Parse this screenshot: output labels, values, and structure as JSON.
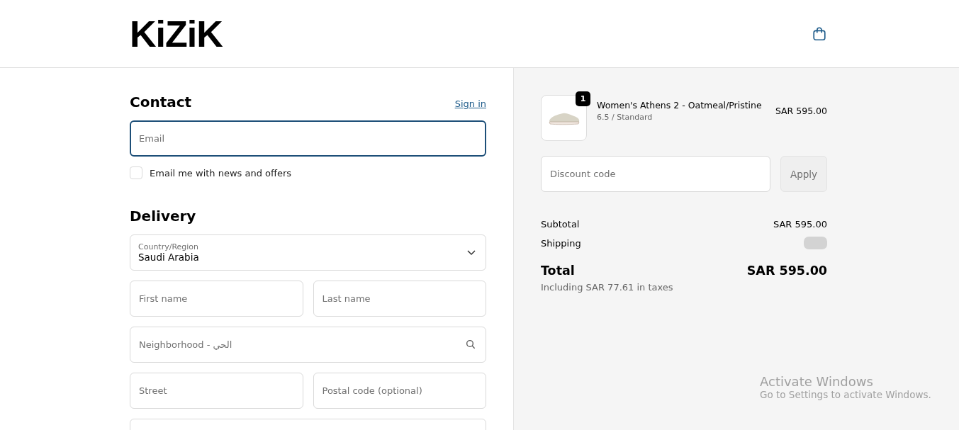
{
  "header": {
    "logo": "KiZiK"
  },
  "contact": {
    "title": "Contact",
    "sign_in": "Sign in",
    "email": {
      "placeholder": "Email",
      "focused": true
    },
    "newsletter": {
      "label": "Email me with news and offers",
      "checked": false
    }
  },
  "delivery": {
    "title": "Delivery",
    "country": {
      "label": "Country/Region",
      "value": "Saudi Arabia"
    },
    "rows": [
      [
        {
          "placeholder": "First name"
        },
        {
          "placeholder": "Last name"
        }
      ],
      [
        {
          "placeholder": "Neighborhood - الحي",
          "kind": "search"
        }
      ],
      [
        {
          "placeholder": "Street"
        },
        {
          "placeholder": "Postal code (optional)"
        }
      ],
      [
        {}
      ]
    ]
  },
  "summary": {
    "item": {
      "name": "Women's Athens 2 - Oatmeal/Pristine",
      "variant": "6.5 / Standard",
      "price": "SAR 595.00",
      "quantity": "1"
    },
    "discount": {
      "placeholder": "Discount code",
      "button": "Apply"
    },
    "subtotal": {
      "label": "Subtotal",
      "value": "SAR 595.00"
    },
    "shipping": {
      "label": "Shipping",
      "loading": true
    },
    "total": {
      "label": "Total",
      "value": "SAR 595.00",
      "taxes": "Including SAR 77.61 in taxes"
    }
  },
  "os_overlay": {
    "title": "Activate Windows",
    "subtitle": "Go to Settings to activate Windows."
  }
}
